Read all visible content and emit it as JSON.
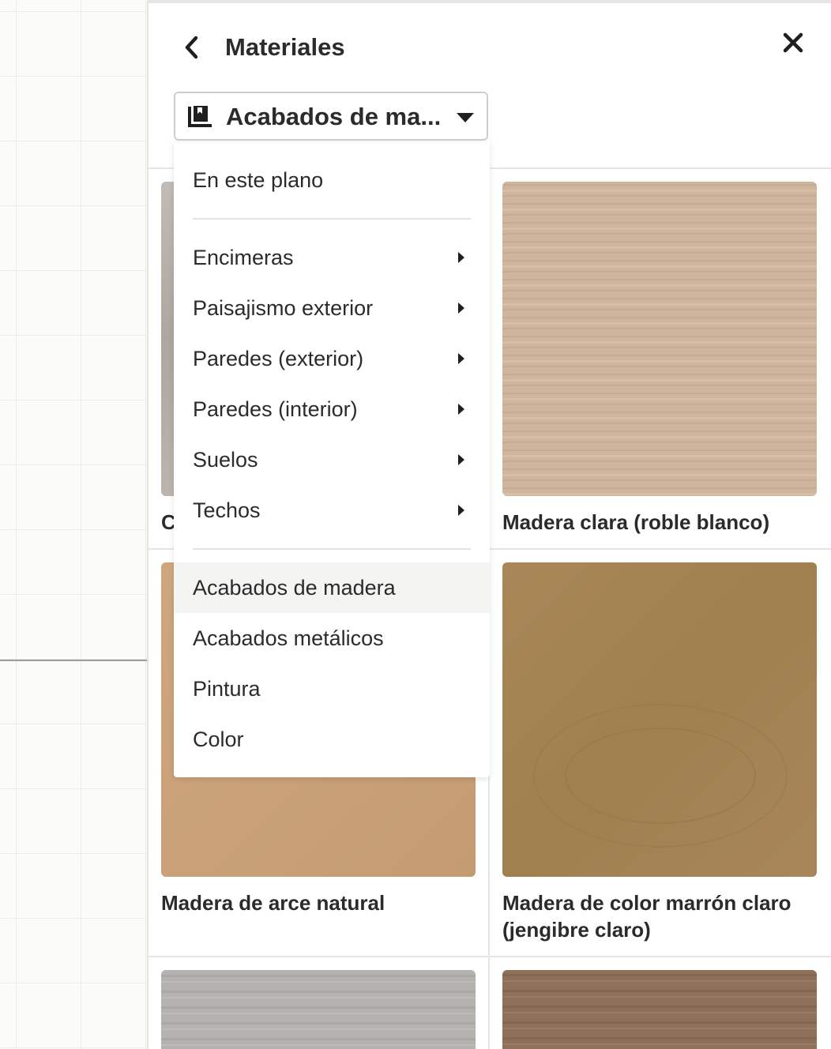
{
  "panel": {
    "title": "Materiales",
    "back_icon": "chevron-left-icon",
    "close_icon": "close-icon"
  },
  "library_dropdown": {
    "icon": "library-book-icon",
    "selected_label": "Acabados de ma...",
    "caret_icon": "caret-down-icon"
  },
  "menu": {
    "top_item": "En este plano",
    "category_items": [
      {
        "label": "Encimeras"
      },
      {
        "label": "Paisajismo exterior"
      },
      {
        "label": "Paredes (exterior)"
      },
      {
        "label": "Paredes (interior)"
      },
      {
        "label": "Suelos"
      },
      {
        "label": "Techos"
      }
    ],
    "library_items": [
      {
        "label": "Acabados de madera",
        "selected": true
      },
      {
        "label": "Acabados metálicos",
        "selected": false
      },
      {
        "label": "Pintura",
        "selected": false
      },
      {
        "label": "Color",
        "selected": false
      }
    ]
  },
  "materials": [
    {
      "label": "C",
      "color": "#b7b1ab"
    },
    {
      "label": "Madera clara (roble blanco)",
      "color": "#cdb39b"
    },
    {
      "label": "Madera de arce natural",
      "color": "#c9a27a"
    },
    {
      "label": "Madera de color marrón claro (jengibre claro)",
      "color": "#a8855a"
    },
    {
      "label": "",
      "color": "#b2b1ad"
    },
    {
      "label": "",
      "color": "#8d6f56"
    }
  ]
}
